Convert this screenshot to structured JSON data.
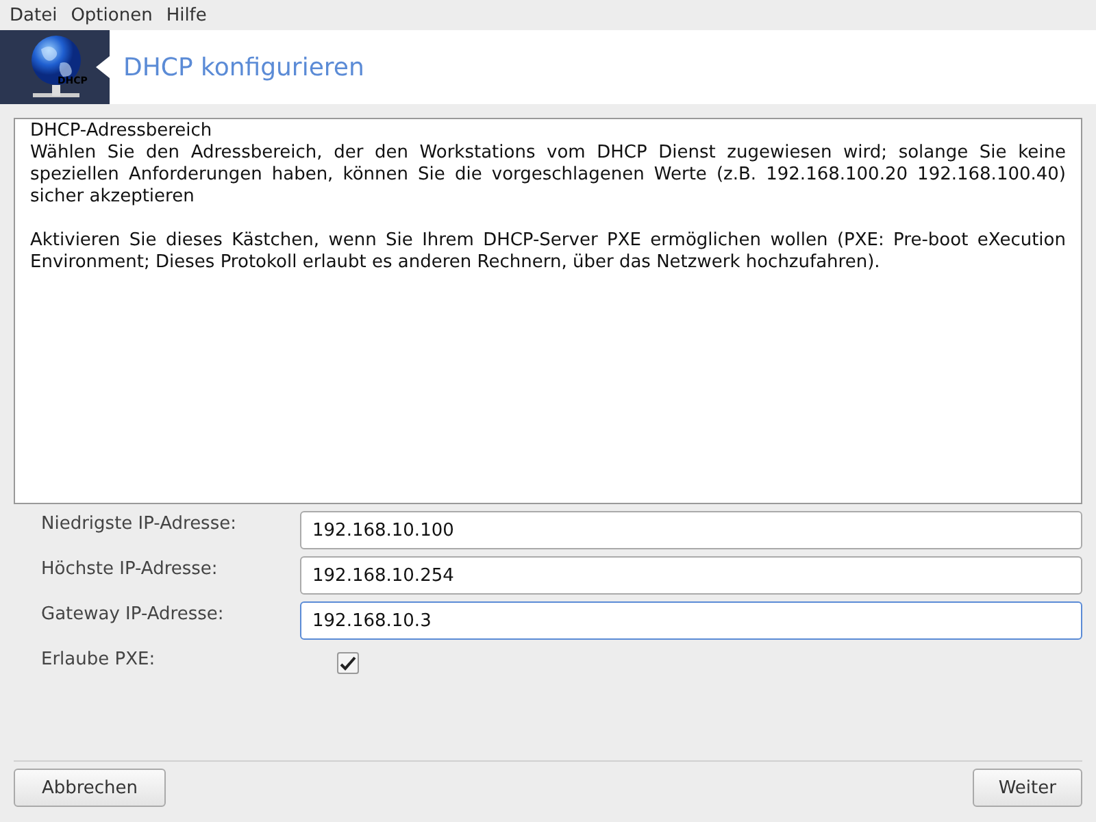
{
  "menu": [
    "Datei",
    "Optionen",
    "Hilfe"
  ],
  "banner": {
    "title": "DHCP konfigurieren",
    "logo_label": "DHCP"
  },
  "info": {
    "heading": "DHCP-Adressbereich",
    "paragraphs": [
      "Wählen Sie den Adressbereich, der den Workstations vom DHCP Dienst zugewiesen wird; solange Sie keine speziellen Anforderungen haben, können Sie die vorgeschlagenen Werte (z.B. 192.168.100.20 192.168.100.40) sicher akzeptieren",
      "Aktivieren Sie dieses Kästchen, wenn Sie Ihrem DHCP-Server PXE ermöglichen wollen (PXE: Pre-boot eXecution Environment; Dieses Protokoll erlaubt es anderen Rechnern, über das Netzwerk hochzufahren)."
    ]
  },
  "fields": [
    {
      "kind": "text",
      "label": "Niedrigste IP-Adresse:",
      "value": "192.168.10.100",
      "focused": false
    },
    {
      "kind": "text",
      "label": "Höchste IP-Adresse:",
      "value": "192.168.10.254",
      "focused": false
    },
    {
      "kind": "text",
      "label": "Gateway IP-Adresse:",
      "value": "192.168.10.3",
      "focused": true
    },
    {
      "kind": "checkbox",
      "label": "Erlaube PXE:",
      "checked": true
    }
  ],
  "buttons": [
    "Abbrechen",
    "Weiter"
  ]
}
